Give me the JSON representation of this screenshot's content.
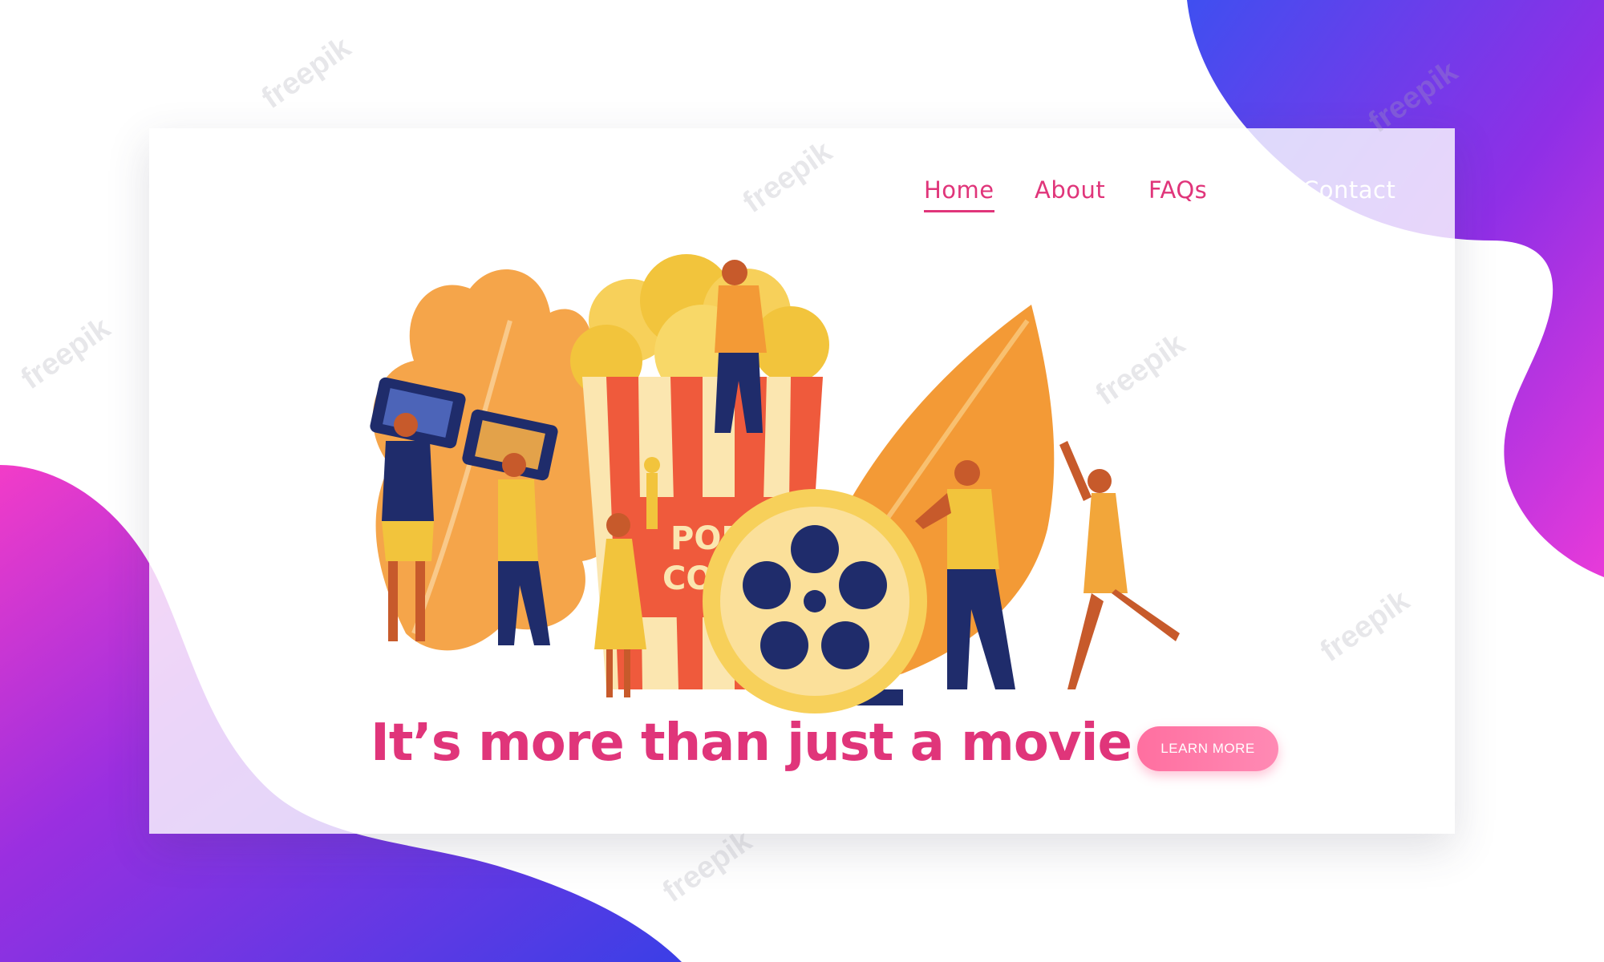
{
  "nav": {
    "home": "Home",
    "about": "About",
    "faqs": "FAQs",
    "contact": "Contact"
  },
  "hero": {
    "tagline": "It’s more than just a movie",
    "cta_label": "LEARN MORE",
    "bucket_text_line1": "POP",
    "bucket_text_line2": "COR"
  },
  "watermark": "freepik",
  "colors": {
    "accent": "#e0357a",
    "cta_start": "#ff6fa0",
    "navy": "#1f2c6b",
    "mustard": "#f2c43c",
    "orange": "#f29a3a",
    "bucket_red": "#ef5a3c",
    "blob_purple": "#7a35e8",
    "blob_magenta": "#e23bd8"
  },
  "icons": [
    "film-reel-icon",
    "3d-glasses-icon",
    "popcorn-bucket-icon",
    "oscar-statuette-icon"
  ]
}
